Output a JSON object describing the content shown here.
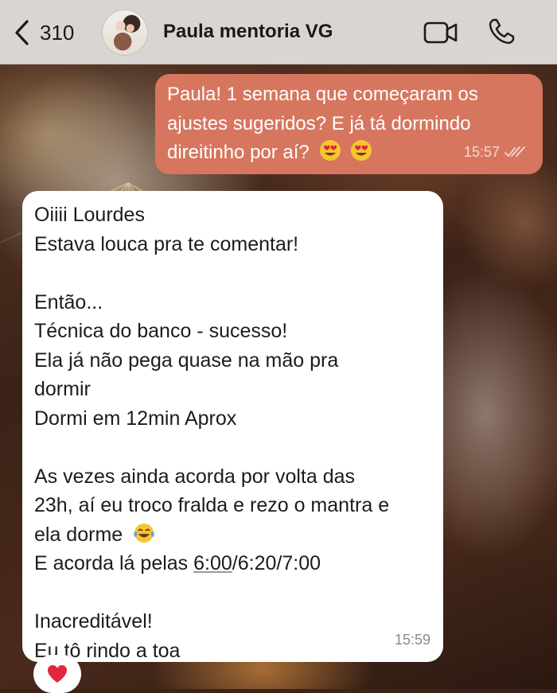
{
  "header": {
    "back_count": "310",
    "contact_name": "Paula mentoria VG"
  },
  "messages": {
    "outgoing": {
      "lines": [
        "Paula! 1 semana que começaram os",
        "ajustes sugeridos? E já tá dormindo",
        "direitinho por aí?"
      ],
      "emojis": [
        "heart-eyes",
        "heart-eyes"
      ],
      "time": "15:57",
      "status": "read"
    },
    "incoming": {
      "lines": [
        "Oiiii Lourdes",
        "Estava louca pra te comentar!",
        "",
        "Então...",
        "Técnica do banco - sucesso!",
        "Ela já não pega quase na mão pra",
        "dormir",
        "Dormi em 12min Aprox",
        "",
        "As vezes ainda acorda por volta das",
        "23h, aí eu troco fralda e rezo o mantra e",
        "ela dorme",
        "E acorda lá pelas ",
        "",
        "Inacreditável!",
        "Eu tô rindo a toa"
      ],
      "linked_time": "6:00",
      "after_link": "/6:20/7:00",
      "emoji_after_line_12": "tears-of-joy",
      "time": "15:59",
      "reaction": "red-heart"
    }
  },
  "colors": {
    "header_bg": "#d9d5d2",
    "outgoing_bubble": "#d7765f",
    "incoming_bubble": "#ffffff",
    "reaction_heart": "#e0283a"
  }
}
